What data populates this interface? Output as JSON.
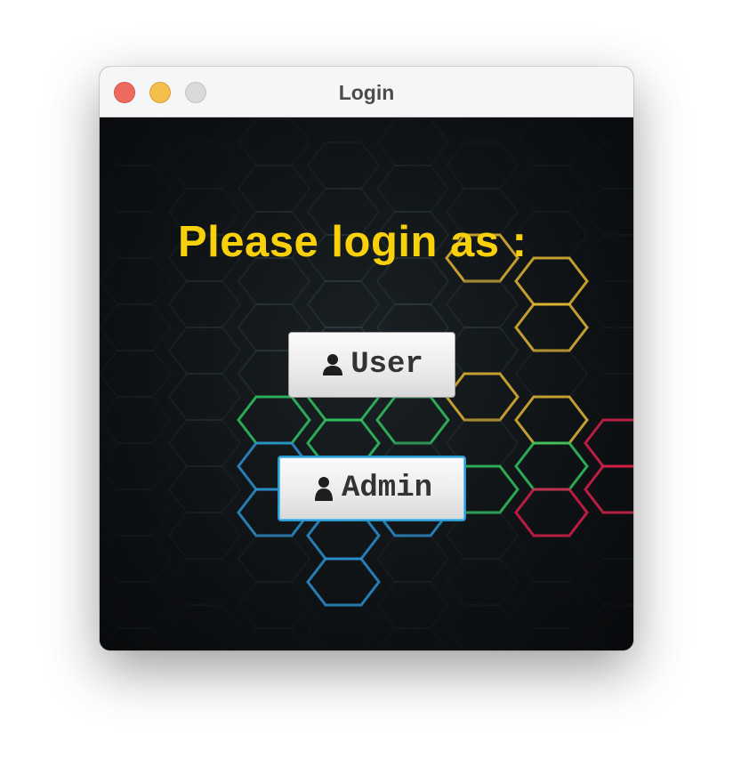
{
  "window": {
    "title": "Login"
  },
  "main": {
    "prompt": "Please login as :",
    "prompt_color": "#f9d10a"
  },
  "buttons": {
    "user_label": "User",
    "user_icon": "person-icon",
    "admin_label": "Admin",
    "admin_icon": "person-icon",
    "focused": "Admin",
    "focus_color": "#2a9bd2"
  },
  "background": {
    "pattern": "hexagon-grid",
    "accent_colors": [
      "#2fc462",
      "#2a8fd0",
      "#e3b632",
      "#d8204a"
    ]
  }
}
